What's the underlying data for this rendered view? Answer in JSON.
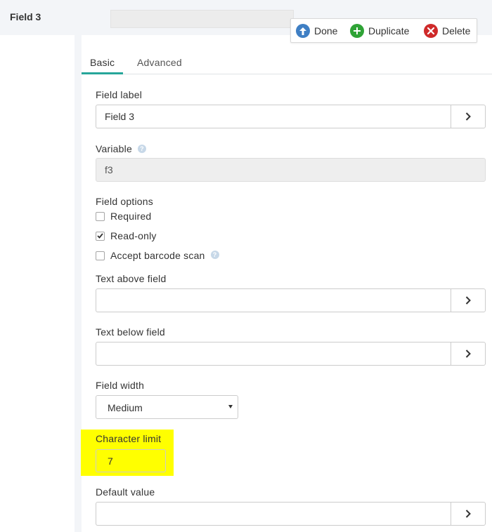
{
  "header": {
    "field_title": "Field 3"
  },
  "actions": {
    "done_label": "Done",
    "duplicate_label": "Duplicate",
    "delete_label": "Delete"
  },
  "tabs": [
    {
      "label": "Basic",
      "active": true
    },
    {
      "label": "Advanced",
      "active": false
    }
  ],
  "form": {
    "field_label": {
      "label": "Field label",
      "value": "Field 3"
    },
    "variable": {
      "label": "Variable",
      "value": "f3"
    },
    "field_options": {
      "label": "Field options",
      "options": [
        {
          "label": "Required",
          "checked": false
        },
        {
          "label": "Read-only",
          "checked": true
        },
        {
          "label": "Accept barcode scan",
          "checked": false
        }
      ]
    },
    "text_above": {
      "label": "Text above field",
      "value": ""
    },
    "text_below": {
      "label": "Text below field",
      "value": ""
    },
    "field_width": {
      "label": "Field width",
      "value": "Medium"
    },
    "character_limit": {
      "label": "Character limit",
      "value": "7"
    },
    "default_value": {
      "label": "Default value",
      "value": ""
    }
  },
  "colors": {
    "accent_tab": "#26a69a",
    "highlight": "#ffff00",
    "done_icon": "#3f7fc4",
    "duplicate_icon": "#2fa336",
    "delete_icon": "#cf2a2a"
  },
  "icons": {
    "done": "arrow-up-circle-icon",
    "duplicate": "plus-circle-icon",
    "delete": "x-circle-icon",
    "expand": "chevron-right-icon",
    "help": "question-circle-icon"
  }
}
